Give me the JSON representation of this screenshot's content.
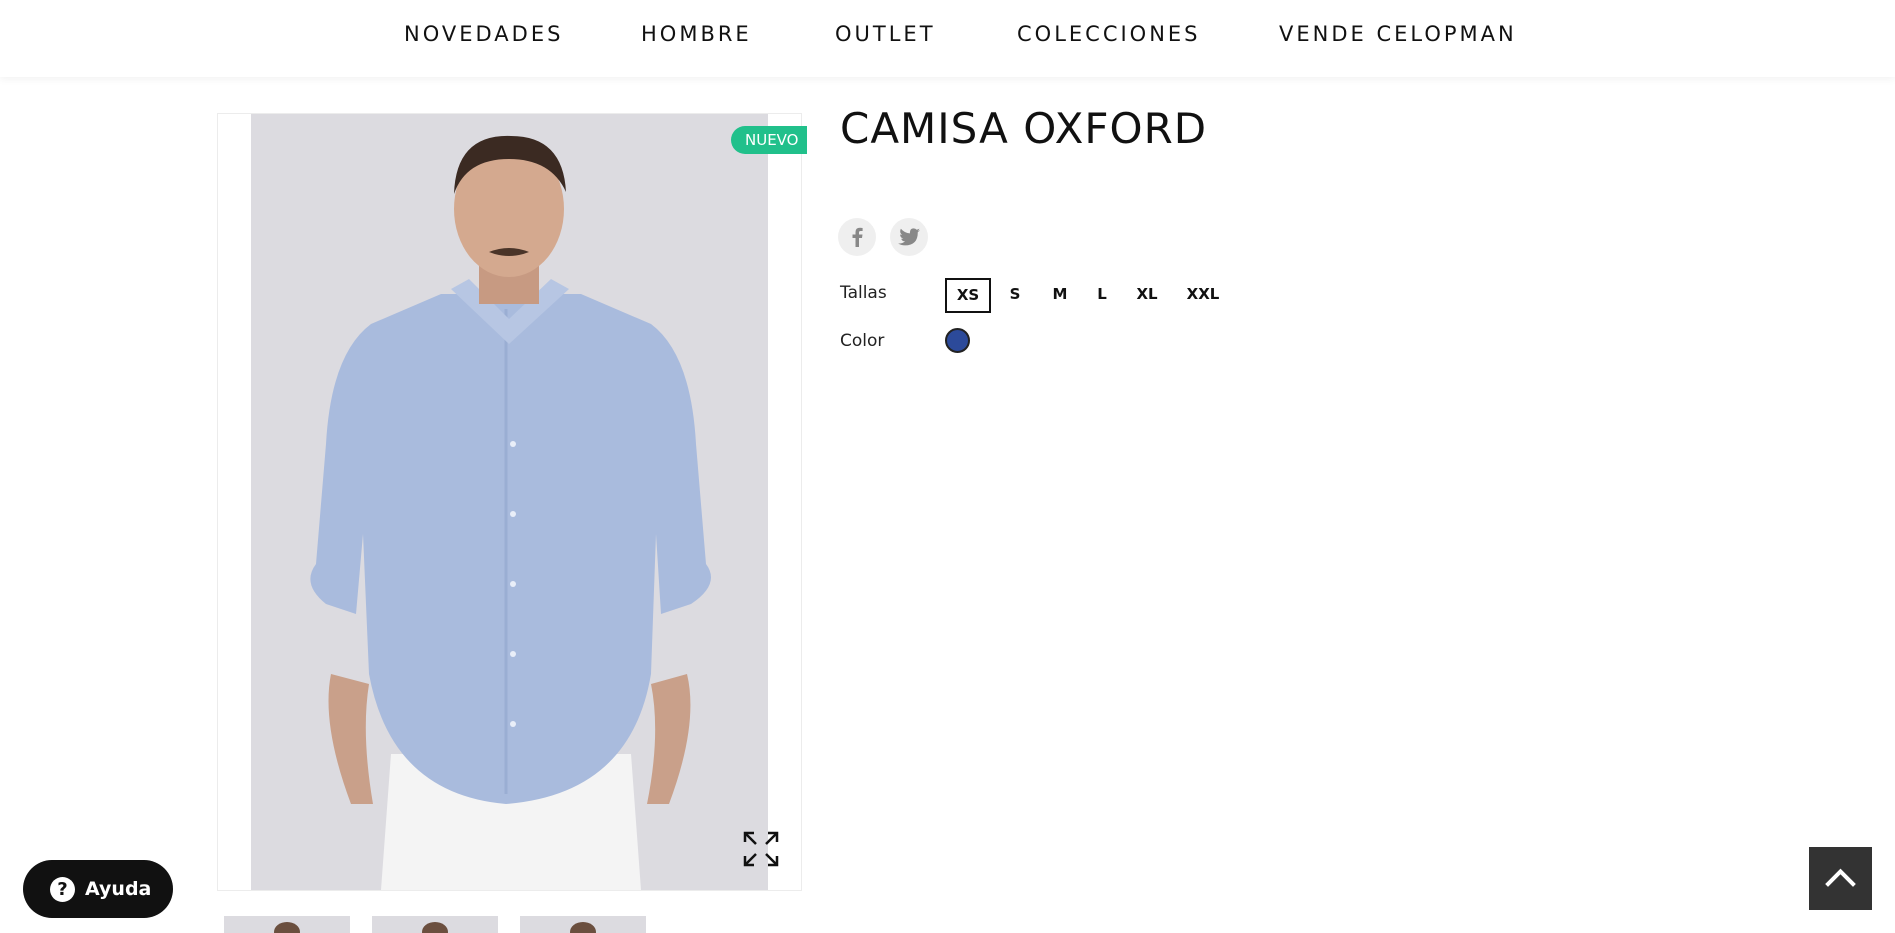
{
  "nav": {
    "items": [
      "NOVEDADES",
      "HOMBRE",
      "OUTLET",
      "COLECCIONES",
      "VENDE CELOPMAN"
    ]
  },
  "product": {
    "title": "CAMISA OXFORD",
    "badge": "NUEVO",
    "image_alt": "Man wearing a light blue oxford shirt",
    "thumbnails_count": 3
  },
  "share": {
    "icons": [
      "facebook-icon",
      "twitter-icon"
    ]
  },
  "options": {
    "sizes_label": "Tallas",
    "sizes": [
      "XS",
      "S",
      "M",
      "L",
      "XL",
      "XXL"
    ],
    "selected_size": "XS",
    "color_label": "Color",
    "color_value": "#2c4a9a"
  },
  "help": {
    "label": "Ayuda"
  },
  "colors": {
    "badge": "#21c08b",
    "text": "#111111",
    "back_to_top": "#333333",
    "help_button": "#111111",
    "photo_bg": "#dcdbe0",
    "shirt": "#a9bbdd"
  }
}
